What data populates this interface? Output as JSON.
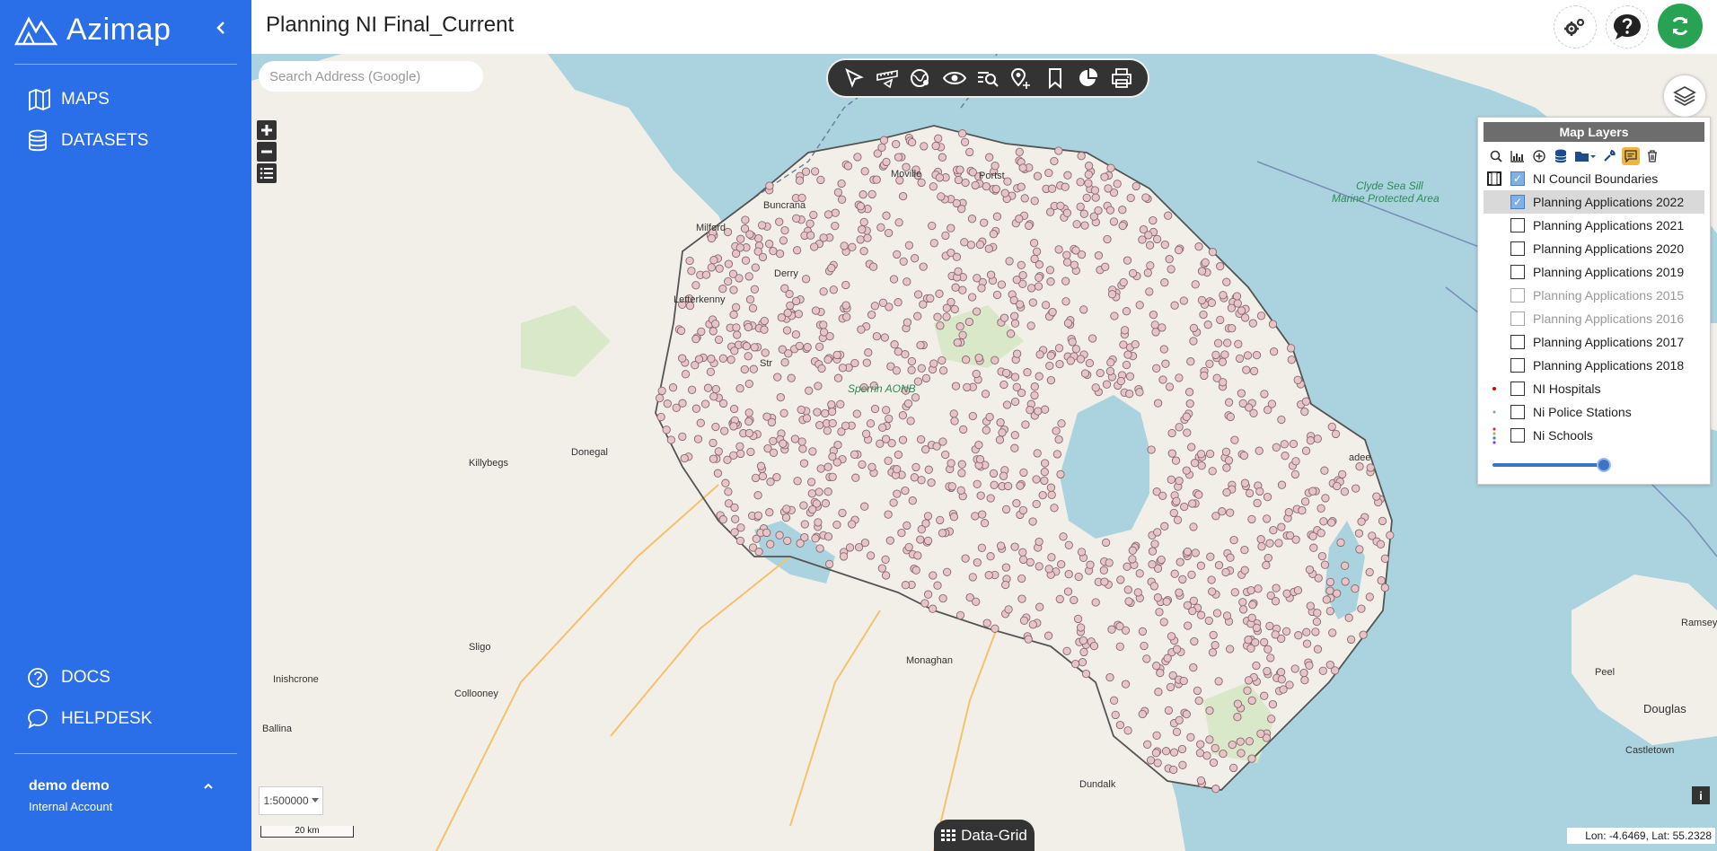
{
  "sidebar": {
    "brand": "Azimap",
    "nav": [
      {
        "label": "MAPS",
        "icon": "map-book-icon"
      },
      {
        "label": "DATASETS",
        "icon": "database-icon"
      }
    ],
    "bottom_nav": [
      {
        "label": "DOCS",
        "icon": "help-circle-icon"
      },
      {
        "label": "HELPDESK",
        "icon": "chat-icon"
      }
    ],
    "user": {
      "name": "demo demo",
      "role": "Internal Account"
    }
  },
  "header": {
    "title": "Planning NI Final_Current"
  },
  "map": {
    "search_placeholder": "Search Address (Google)",
    "scale_value": "1:500000",
    "scalebar_label": "20 km",
    "datagrid_label": "Data-Grid",
    "info_label": "i",
    "coords": "Lon: -4.6469, Lat: 55.2328",
    "places": [
      {
        "name": "Moville"
      },
      {
        "name": "Portst"
      },
      {
        "name": "Buncrana"
      },
      {
        "name": "Milford"
      },
      {
        "name": "Derry"
      },
      {
        "name": "Letterkenny"
      },
      {
        "name": "Str"
      },
      {
        "name": "Sperrin AONB"
      },
      {
        "name": "Killybegs"
      },
      {
        "name": "Donegal"
      },
      {
        "name": "Sligo"
      },
      {
        "name": "Inishcrone"
      },
      {
        "name": "Collooney"
      },
      {
        "name": "Ballina"
      },
      {
        "name": "Monaghan"
      },
      {
        "name": "Dundalk"
      },
      {
        "name": "adee"
      },
      {
        "name": "Clyde Sea Sill"
      },
      {
        "name": "Marine Protected Area"
      },
      {
        "name": "Ramsey"
      },
      {
        "name": "Peel"
      },
      {
        "name": "Douglas"
      },
      {
        "name": "Castletown"
      }
    ]
  },
  "layers_panel": {
    "title": "Map Layers",
    "opacity": 1.0,
    "layers": [
      {
        "name": "NI Council Boundaries",
        "checked": true,
        "dim": false,
        "selected": false,
        "legend": "boundary-legend-icon"
      },
      {
        "name": "Planning Applications 2022",
        "checked": true,
        "dim": false,
        "selected": true,
        "legend": ""
      },
      {
        "name": "Planning Applications 2021",
        "checked": false,
        "dim": false,
        "selected": false,
        "legend": ""
      },
      {
        "name": "Planning Applications 2020",
        "checked": false,
        "dim": false,
        "selected": false,
        "legend": ""
      },
      {
        "name": "Planning Applications 2019",
        "checked": false,
        "dim": false,
        "selected": false,
        "legend": ""
      },
      {
        "name": "Planning Applications 2015",
        "checked": false,
        "dim": true,
        "selected": false,
        "legend": ""
      },
      {
        "name": "Planning Applications 2016",
        "checked": false,
        "dim": true,
        "selected": false,
        "legend": ""
      },
      {
        "name": "Planning Applications 2017",
        "checked": false,
        "dim": false,
        "selected": false,
        "legend": ""
      },
      {
        "name": "Planning Applications 2018",
        "checked": false,
        "dim": false,
        "selected": false,
        "legend": ""
      },
      {
        "name": "NI Hospitals",
        "checked": false,
        "dim": false,
        "selected": false,
        "legend": "red-dot-legend-icon"
      },
      {
        "name": "Ni Police Stations",
        "checked": false,
        "dim": false,
        "selected": false,
        "legend": "blue-dot-legend-icon"
      },
      {
        "name": "Ni Schools",
        "checked": false,
        "dim": false,
        "selected": false,
        "legend": "multi-dot-legend-icon"
      }
    ]
  },
  "colors": {
    "sidebar": "#2a6ee8",
    "sea": "#aad3df",
    "land": "#f2efe9",
    "point_fill": "#e6c4c8",
    "point_stroke": "#8a6a6e",
    "refresh": "#27a353"
  }
}
